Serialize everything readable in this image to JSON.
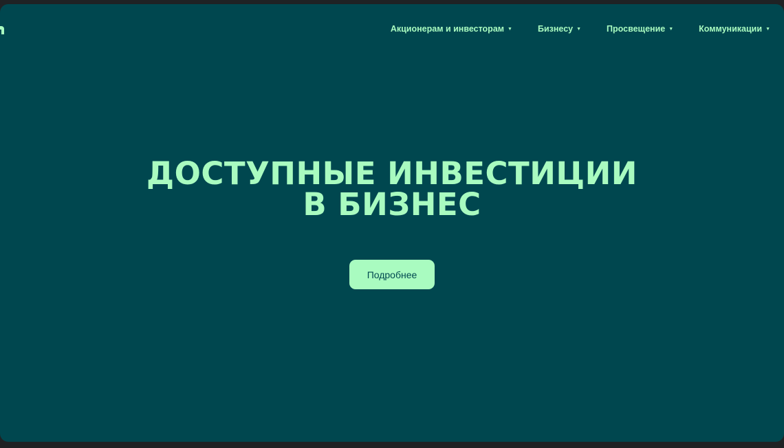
{
  "nav": {
    "items": [
      {
        "label": "Акционерам и инвесторам",
        "icon": "caret-down-icon"
      },
      {
        "label": "Бизнесу",
        "icon": "caret-down-icon"
      },
      {
        "label": "Просвещение",
        "icon": "caret-down-icon"
      },
      {
        "label": "Коммуникации",
        "icon": "caret-down-icon"
      }
    ]
  },
  "hero": {
    "title_line1": "ДОСТУПНЫЕ ИНВЕСТИЦИИ",
    "title_line2": "В БИЗНЕС",
    "cta_label": "Подробнее"
  },
  "colors": {
    "background": "#00474f",
    "accent": "#a9fbc0",
    "frame": "#1f2224"
  }
}
